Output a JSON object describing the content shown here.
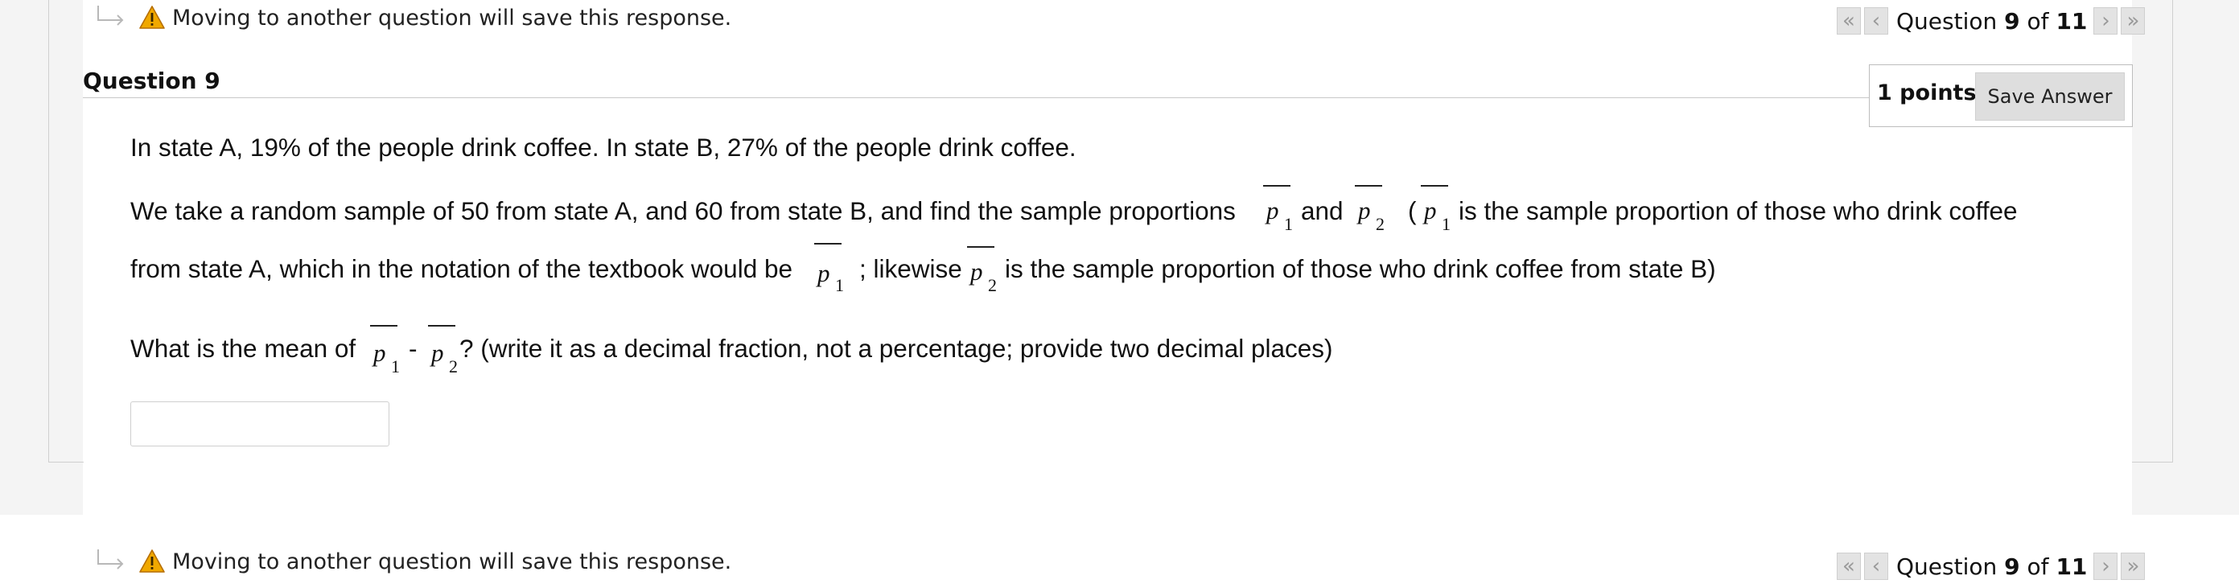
{
  "warning": {
    "top_text": "Moving to another question will save this response.",
    "bottom_text": "Moving to another question will save this response."
  },
  "pager": {
    "prefix": "Question",
    "current": "9",
    "of": "of",
    "total": "11"
  },
  "question": {
    "title": "Question 9",
    "points": "1 points",
    "save_label": "Save Answer",
    "line1": "In state A, 19% of the people drink coffee.  In state B, 27% of the people drink coffee.",
    "line2a": "We take a random sample of 50 from state A, and 60 from state B, and find the sample proportions",
    "line2b": "and",
    "line2c": "(",
    "line2d": "is the sample proportion of those who drink coffee",
    "line3a": "from state A, which in the notation of the textbook would be",
    "line3b": "; likewise",
    "line3c": "is the sample proportion of those who drink coffee from state B)",
    "line4a": "What is the mean of",
    "line4b": "-",
    "line4c": "?  (write it as a decimal fraction, not a percentage; provide two decimal places)",
    "symbol_p": "p",
    "sub1": "1",
    "sub2": "2",
    "answer_value": ""
  },
  "icons": {
    "warning": "warning-triangle-icon",
    "hook": "return-arrow-icon",
    "first": "double-chevron-left-icon",
    "prev": "chevron-left-icon",
    "next": "chevron-right-icon",
    "last": "double-chevron-right-icon"
  },
  "colors": {
    "warning_fill": "#f0a800",
    "page_gray": "#f4f4f4",
    "button_gray": "#dedede"
  }
}
